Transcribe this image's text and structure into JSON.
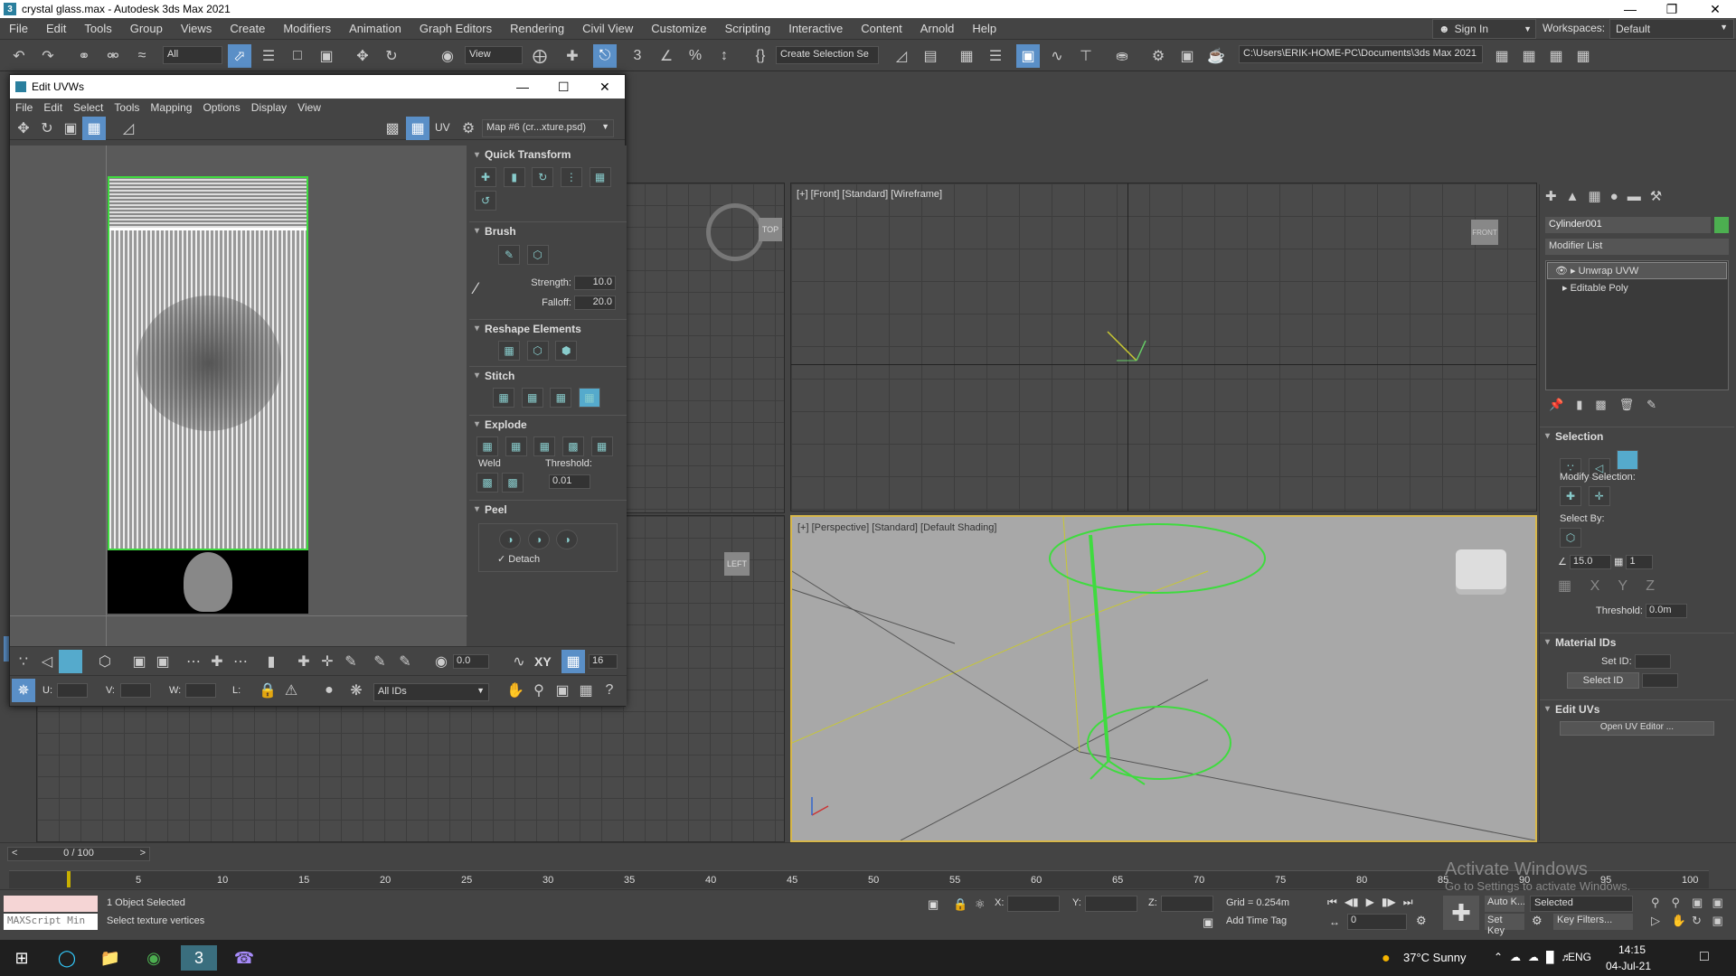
{
  "window": {
    "title": "crystal glass.max - Autodesk 3ds Max 2021"
  },
  "menu": [
    "File",
    "Edit",
    "Tools",
    "Group",
    "Views",
    "Create",
    "Modifiers",
    "Animation",
    "Graph Editors",
    "Rendering",
    "Civil View",
    "Customize",
    "Scripting",
    "Interactive",
    "Content",
    "Arnold",
    "Help"
  ],
  "signin": "Sign In",
  "workspaces": {
    "label": "Workspaces:",
    "value": "Default"
  },
  "toolbar": {
    "filter": "All",
    "refcoord": "View",
    "selset": "Create Selection Se",
    "path": "C:\\Users\\ERIK-HOME-PC\\Documents\\3ds Max 2021"
  },
  "uvw": {
    "title": "Edit UVWs",
    "menu": [
      "File",
      "Edit",
      "Select",
      "Tools",
      "Mapping",
      "Options",
      "Display",
      "View"
    ],
    "uv_label": "UV",
    "map": "Map #6 (cr...xture.psd)",
    "quick_transform": "Quick Transform",
    "brush": "Brush",
    "strength_label": "Strength:",
    "strength": "10.0",
    "falloff_label": "Falloff:",
    "falloff": "20.0",
    "reshape": "Reshape Elements",
    "stitch": "Stitch",
    "explode": "Explode",
    "weld": "Weld",
    "threshold_label": "Threshold:",
    "threshold": "0.01",
    "peel": "Peel",
    "detach": "Detach",
    "angle": "0.0",
    "xy": "XY",
    "grid_count": "16",
    "u_label": "U:",
    "v_label": "V:",
    "w_label": "W:",
    "l_label": "L:",
    "ids": "All IDs"
  },
  "viewports": {
    "front": "[+] [Front] [Standard] [Wireframe]",
    "persp": "[+] [Perspective] [Standard] [Default Shading]",
    "top_cube": "TOP",
    "left_cube": "LEFT",
    "front_cube": "FRONT"
  },
  "cmd": {
    "object_name": "Cylinder001",
    "modifier_list": "Modifier List",
    "stack": [
      "Unwrap UVW",
      "Editable Poly"
    ],
    "selection": "Selection",
    "modify_selection": "Modify Selection:",
    "select_by": "Select By:",
    "angle": "15.0",
    "count": "1",
    "threshold_label": "Threshold:",
    "threshold": "0.0m",
    "material_ids": "Material IDs",
    "set_id": "Set ID:",
    "select_id": "Select ID",
    "edit_uvs": "Edit UVs",
    "open_uv": "Open UV Editor ..."
  },
  "timeline": {
    "frame": "0 / 100",
    "ticks": [
      "5",
      "10",
      "15",
      "20",
      "25",
      "30",
      "35",
      "40",
      "45",
      "50",
      "55",
      "60",
      "65",
      "70",
      "75",
      "80",
      "85",
      "90",
      "95",
      "100"
    ]
  },
  "status": {
    "maxscript": "MAXScript Min",
    "selected": "1 Object Selected",
    "prompt": "Select texture vertices",
    "x": "X:",
    "y": "Y:",
    "z": "Z:",
    "grid": "Grid = 0.254m",
    "add_time_tag": "Add Time Tag",
    "auto_key": "Auto K...",
    "selected_drop": "Selected",
    "set_key": "Set Key",
    "key_filters": "Key Filters...",
    "frame_field": "0",
    "watermark1": "Activate Windows",
    "watermark2": "Go to Settings to activate Windows."
  },
  "taskbar": {
    "weather": "37°C  Sunny",
    "lang": "ENG",
    "time": "14:15",
    "date": "04-Jul-21"
  }
}
